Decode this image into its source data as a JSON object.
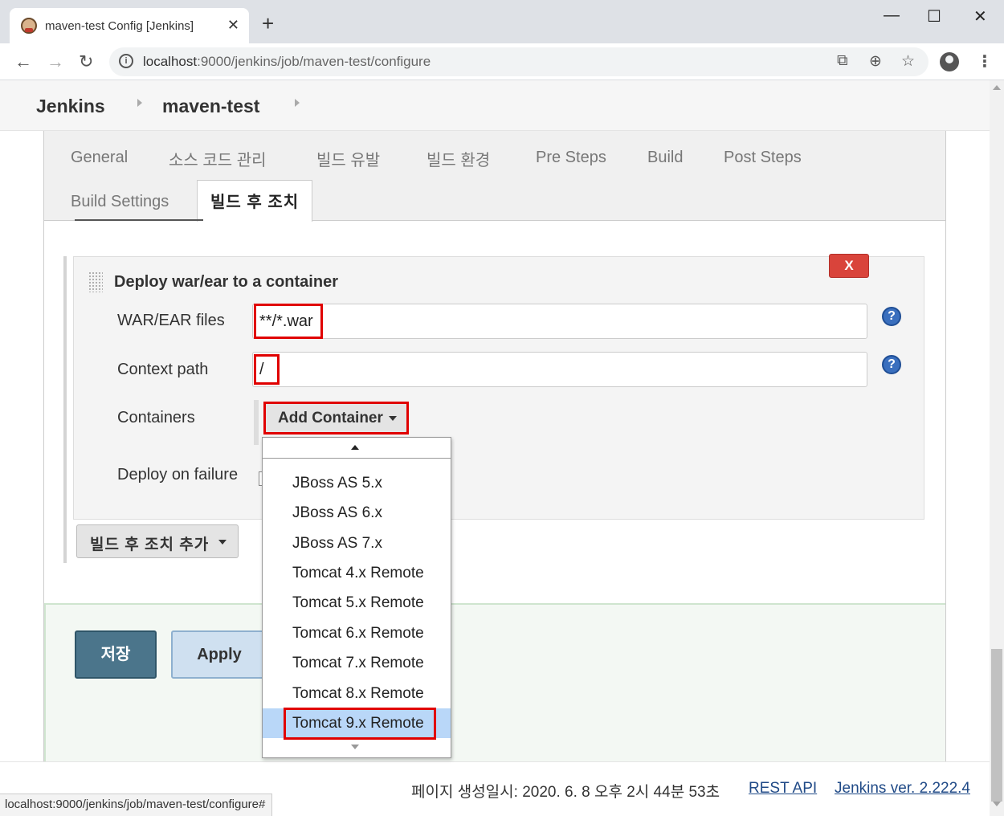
{
  "browser": {
    "tab_title": "maven-test Config [Jenkins]",
    "tab_close": "✕",
    "new_tab": "+",
    "url_host": "localhost",
    "url_rest": ":9000/jenkins/job/maven-test/configure",
    "window": {
      "minimize": "—",
      "maximize": "☐",
      "close": "✕"
    },
    "nav": {
      "back": "←",
      "forward": "→",
      "reload": "↻"
    }
  },
  "breadcrumbs": [
    "Jenkins",
    "maven-test"
  ],
  "config_tabs": {
    "row1": [
      "General",
      "소스 코드 관리",
      "빌드 유발",
      "빌드 환경",
      "Pre Steps",
      "Build",
      "Post Steps"
    ],
    "row2": [
      "Build Settings"
    ],
    "active": "빌드 후 조치"
  },
  "deploy": {
    "title": "Deploy war/ear to a container",
    "delete_label": "X",
    "war_label": "WAR/EAR files",
    "war_value": "**/*.war",
    "context_label": "Context path",
    "context_value": "/",
    "containers_label": "Containers",
    "add_container_label": "Add Container",
    "deploy_failure_label": "Deploy on failure",
    "help_glyph": "?"
  },
  "add_postbuild_label": "빌드 후 조치 추가",
  "buttons": {
    "save": "저장",
    "apply": "Apply"
  },
  "container_menu": {
    "items": [
      "JBoss AS 5.x",
      "JBoss AS 6.x",
      "JBoss AS 7.x",
      "Tomcat 4.x Remote",
      "Tomcat 5.x Remote",
      "Tomcat 6.x Remote",
      "Tomcat 7.x Remote",
      "Tomcat 8.x Remote",
      "Tomcat 9.x Remote"
    ],
    "selected": "Tomcat 9.x Remote"
  },
  "footer": {
    "generated": "페이지 생성일시: 2020. 6. 8 오후 2시 44분 53초",
    "rest_api": "REST API",
    "version": "Jenkins ver. 2.222.4"
  },
  "status_url": "localhost:9000/jenkins/job/maven-test/configure#",
  "colors": {
    "highlight": "#e00000",
    "save_bg": "#4b758b",
    "delete_bg": "#d9443b",
    "selected_item": "#b9d7f8"
  },
  "icons": [
    "jenkins-favicon",
    "back-arrow-icon",
    "forward-arrow-icon",
    "reload-icon",
    "site-info-icon",
    "translate-icon",
    "zoom-icon",
    "bookmark-star-icon",
    "profile-icon",
    "menu-kebab-icon",
    "drag-handle-icon",
    "help-icon",
    "caret-down-icon"
  ]
}
